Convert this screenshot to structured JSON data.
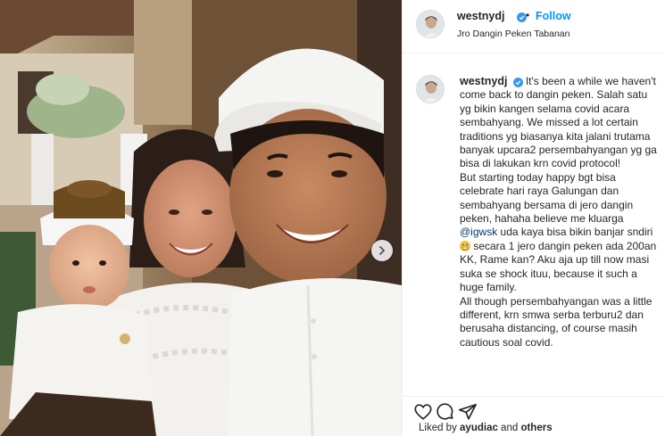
{
  "post": {
    "username": "westnydj",
    "follow_label": "Follow",
    "separator": "•",
    "location": "Jro Dangin Peken Tabanan"
  },
  "caption": {
    "part1": "It's been a while we haven't come back to dangin peken. Salah satu yg bikin kangen selama covid acara sembahyang. We missed a lot certain traditions yg biasanya kita jalani trutama banyak upcara2 persembahyangan yg ga bisa di lakukan krn covid protocol!\nBut starting today happy bgt bisa celebrate hari raya Galungan dan sembahyang bersama di jero dangin peken, hahaha believe me kluarga ",
    "mention": "@igwsk",
    "part2": " uda kaya bisa bikin banjar sndiri ",
    "part3": " secara 1 jero dangin peken ada 200an KK, Rame kan? Aku aja up till now masi suka se shock ituu, because it such a huge family.\nAll though persembahyangan was a little different, krn smwa serba terburu2 dan berusaha distancing, of course masih cautious soal covid."
  },
  "likes": {
    "prefix": "Liked by ",
    "user": "ayudiac",
    "middle": " and ",
    "others": "others"
  },
  "icons": {
    "like": "heart-icon",
    "comment": "comment-icon",
    "share": "paper-plane-icon",
    "next": "chevron-right-icon",
    "verified": "verified-badge-icon",
    "emoji": "grimacing-emoji-icon"
  },
  "colors": {
    "link_blue": "#0095f6",
    "verified_blue": "#3897f0",
    "mention": "#00376b",
    "text": "#262626",
    "border": "#efefef"
  }
}
